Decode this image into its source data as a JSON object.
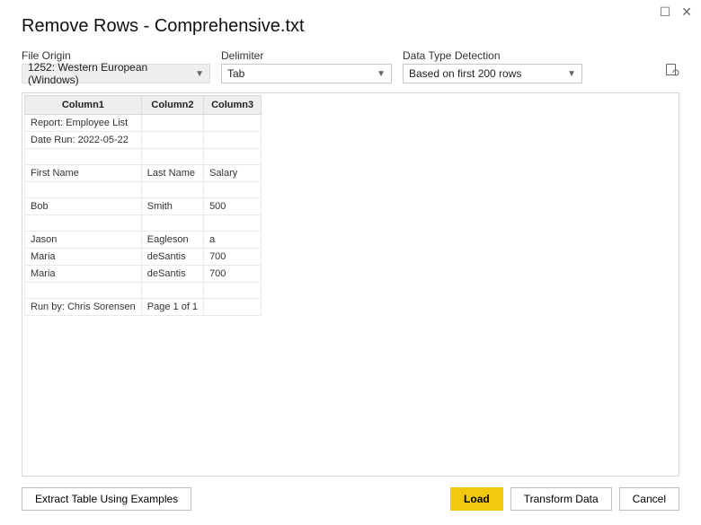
{
  "window": {
    "title": "Remove Rows - Comprehensive.txt"
  },
  "controls": {
    "fileOrigin": {
      "label": "File Origin",
      "value": "1252: Western European (Windows)"
    },
    "delimiter": {
      "label": "Delimiter",
      "value": "Tab"
    },
    "dataTypeDetection": {
      "label": "Data Type Detection",
      "value": "Based on first 200 rows"
    }
  },
  "table": {
    "columns": [
      "Column1",
      "Column2",
      "Column3"
    ],
    "rows": [
      [
        "Report: Employee List",
        "",
        ""
      ],
      [
        "Date Run: 2022-05-22",
        "",
        ""
      ],
      [
        "",
        "",
        ""
      ],
      [
        "First Name",
        "Last Name",
        "Salary"
      ],
      [
        "",
        "",
        ""
      ],
      [
        "Bob",
        "Smith",
        "500"
      ],
      [
        "",
        "",
        ""
      ],
      [
        "Jason",
        "Eagleson",
        "a"
      ],
      [
        "Maria",
        "deSantis",
        "700"
      ],
      [
        "Maria",
        "deSantis",
        "700"
      ],
      [
        "",
        "",
        ""
      ],
      [
        "Run by: Chris Sorensen",
        "Page 1 of 1",
        ""
      ]
    ]
  },
  "footer": {
    "extract": "Extract Table Using Examples",
    "load": "Load",
    "transform": "Transform Data",
    "cancel": "Cancel"
  }
}
